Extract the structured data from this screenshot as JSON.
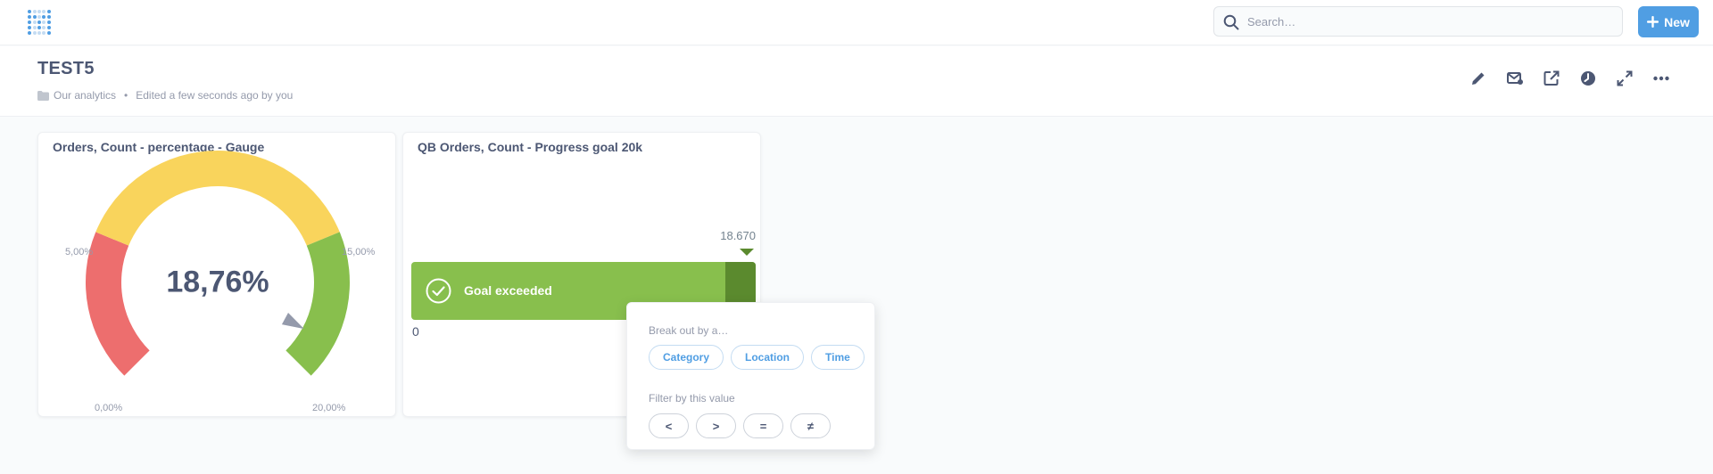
{
  "nav": {
    "logo_icon": "metabase-logo-icon",
    "search": {
      "placeholder": "Search…",
      "value": ""
    },
    "new_label": "New"
  },
  "dashboard": {
    "title": "TEST5",
    "collection": "Our analytics",
    "edited": "Edited a few seconds ago by you",
    "actions": [
      "pencil-icon",
      "subscription-icon",
      "share-icon",
      "history-icon",
      "fullscreen-icon",
      "more-icon"
    ]
  },
  "cards": [
    {
      "title": "Orders, Count - percentage - Gauge",
      "type": "gauge",
      "value_label": "18,76%",
      "value": 18.76,
      "range": [
        0,
        20
      ],
      "segments": [
        {
          "min": 0,
          "max": 5,
          "color": "#ed6e6e"
        },
        {
          "min": 5,
          "max": 15,
          "color": "#f9d45c"
        },
        {
          "min": 15,
          "max": 20,
          "color": "#88bf4d"
        }
      ],
      "labels": [
        "0,00%",
        "5,00%",
        "15,00%",
        "20,00%"
      ]
    },
    {
      "title": "QB Orders, Count - Progress goal 20k",
      "type": "progress",
      "value_label": "18.670",
      "status": "Goal exceeded",
      "zero_label": "0",
      "colors": {
        "fill": "#88bf4d",
        "exceeded": "#5b8a2e"
      }
    }
  ],
  "popover": {
    "breakout_heading": "Break out by a…",
    "breakout_options": [
      "Category",
      "Location",
      "Time"
    ],
    "filter_heading": "Filter by this value",
    "filter_ops": [
      "<",
      ">",
      "=",
      "≠"
    ]
  },
  "colors": {
    "brand": "#509ee3",
    "text": "#4c5773",
    "muted": "#949aab"
  }
}
